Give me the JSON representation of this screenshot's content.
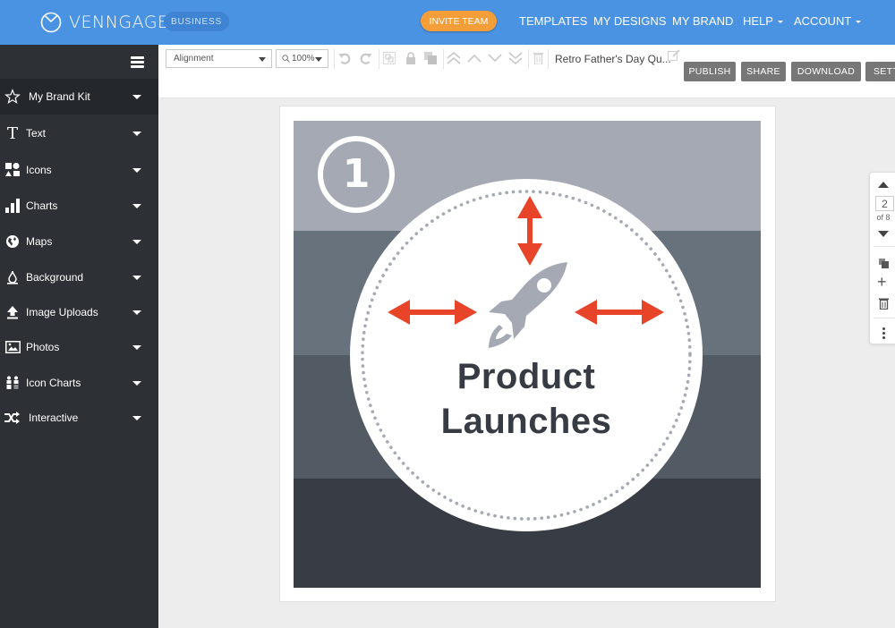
{
  "app": {
    "brand": "VENNGAGE",
    "plan_badge": "BUSINESS"
  },
  "topnav": {
    "invite_label": "INVITE TEAM",
    "items": [
      {
        "label": "TEMPLATES",
        "has_dropdown": false
      },
      {
        "label": "MY DESIGNS",
        "has_dropdown": false
      },
      {
        "label": "MY BRAND",
        "has_dropdown": false
      },
      {
        "label": "HELP",
        "has_dropdown": true
      },
      {
        "label": "ACCOUNT",
        "has_dropdown": true
      }
    ]
  },
  "sidebar": {
    "items": [
      {
        "label": "My Brand Kit",
        "icon": "star-icon",
        "active": true
      },
      {
        "label": "Text",
        "icon": "text-icon",
        "active": false
      },
      {
        "label": "Icons",
        "icon": "shapes-icon",
        "active": false
      },
      {
        "label": "Charts",
        "icon": "bar-chart-icon",
        "active": false
      },
      {
        "label": "Maps",
        "icon": "globe-icon",
        "active": false
      },
      {
        "label": "Background",
        "icon": "drop-icon",
        "active": false
      },
      {
        "label": "Image Uploads",
        "icon": "upload-icon",
        "active": false
      },
      {
        "label": "Photos",
        "icon": "photo-icon",
        "active": false
      },
      {
        "label": "Icon Charts",
        "icon": "people-chart-icon",
        "active": false
      },
      {
        "label": "Interactive",
        "icon": "shuffle-icon",
        "active": false
      }
    ]
  },
  "toolbar": {
    "alignment_value": "Alignment",
    "zoom_value": "100%",
    "document_title": "Retro Father's Day Qu...",
    "buttons": {
      "publish": "PUBLISH",
      "share": "SHARE",
      "download": "DOWNLOAD",
      "settings": "SETT"
    }
  },
  "canvas": {
    "step_number": "1",
    "headline_line1": "Product",
    "headline_line2": "Launches",
    "colors": {
      "band1": "#a5a9b4",
      "band2": "#68727c",
      "band3": "#525a64",
      "band4": "#383d45",
      "arrow": "#e8442a",
      "rocket": "#a5a9b4",
      "text": "#363b44"
    }
  },
  "pages": {
    "current": "2",
    "total_label": "of 8"
  }
}
